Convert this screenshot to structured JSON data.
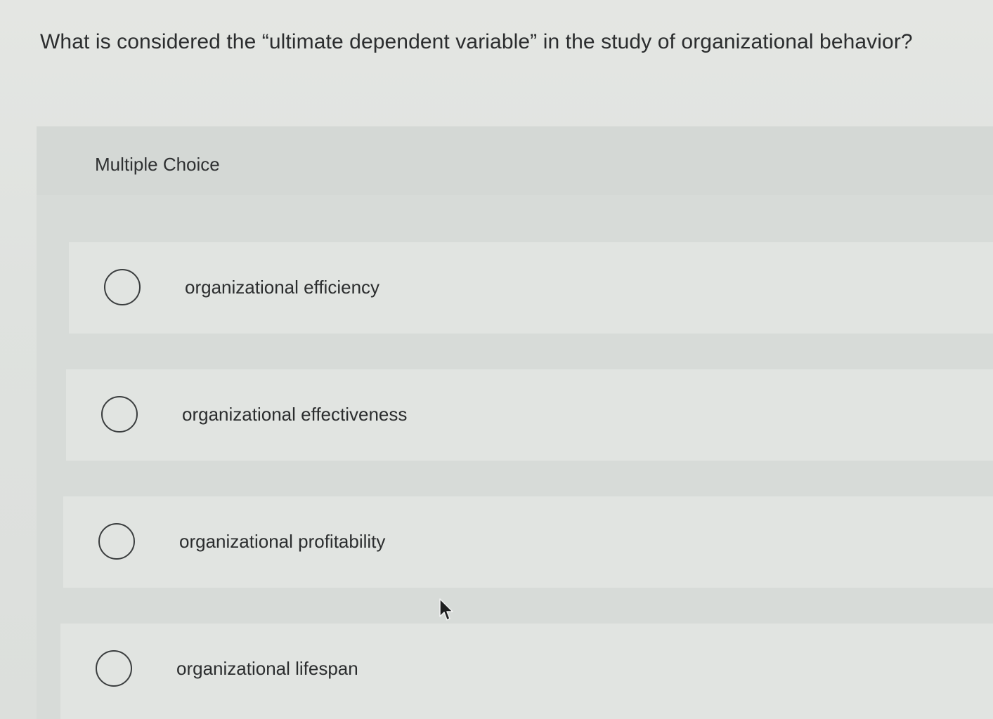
{
  "question": {
    "text": "What is considered the “ultimate dependent variable” in the study of organizational behavior?"
  },
  "multiple_choice": {
    "label": "Multiple Choice",
    "options": [
      {
        "label": "organizational efficiency",
        "selected": false
      },
      {
        "label": "organizational effectiveness",
        "selected": false
      },
      {
        "label": "organizational profitability",
        "selected": false
      },
      {
        "label": "organizational lifespan",
        "selected": false
      }
    ]
  },
  "icons": {
    "radio": "radio-circle-icon",
    "cursor": "mouse-pointer-icon"
  },
  "colors": {
    "background": "#dcdfdc",
    "option_background": "#e1e4e1",
    "text": "#2b2d2e",
    "radio_border": "#3a3d3e"
  }
}
